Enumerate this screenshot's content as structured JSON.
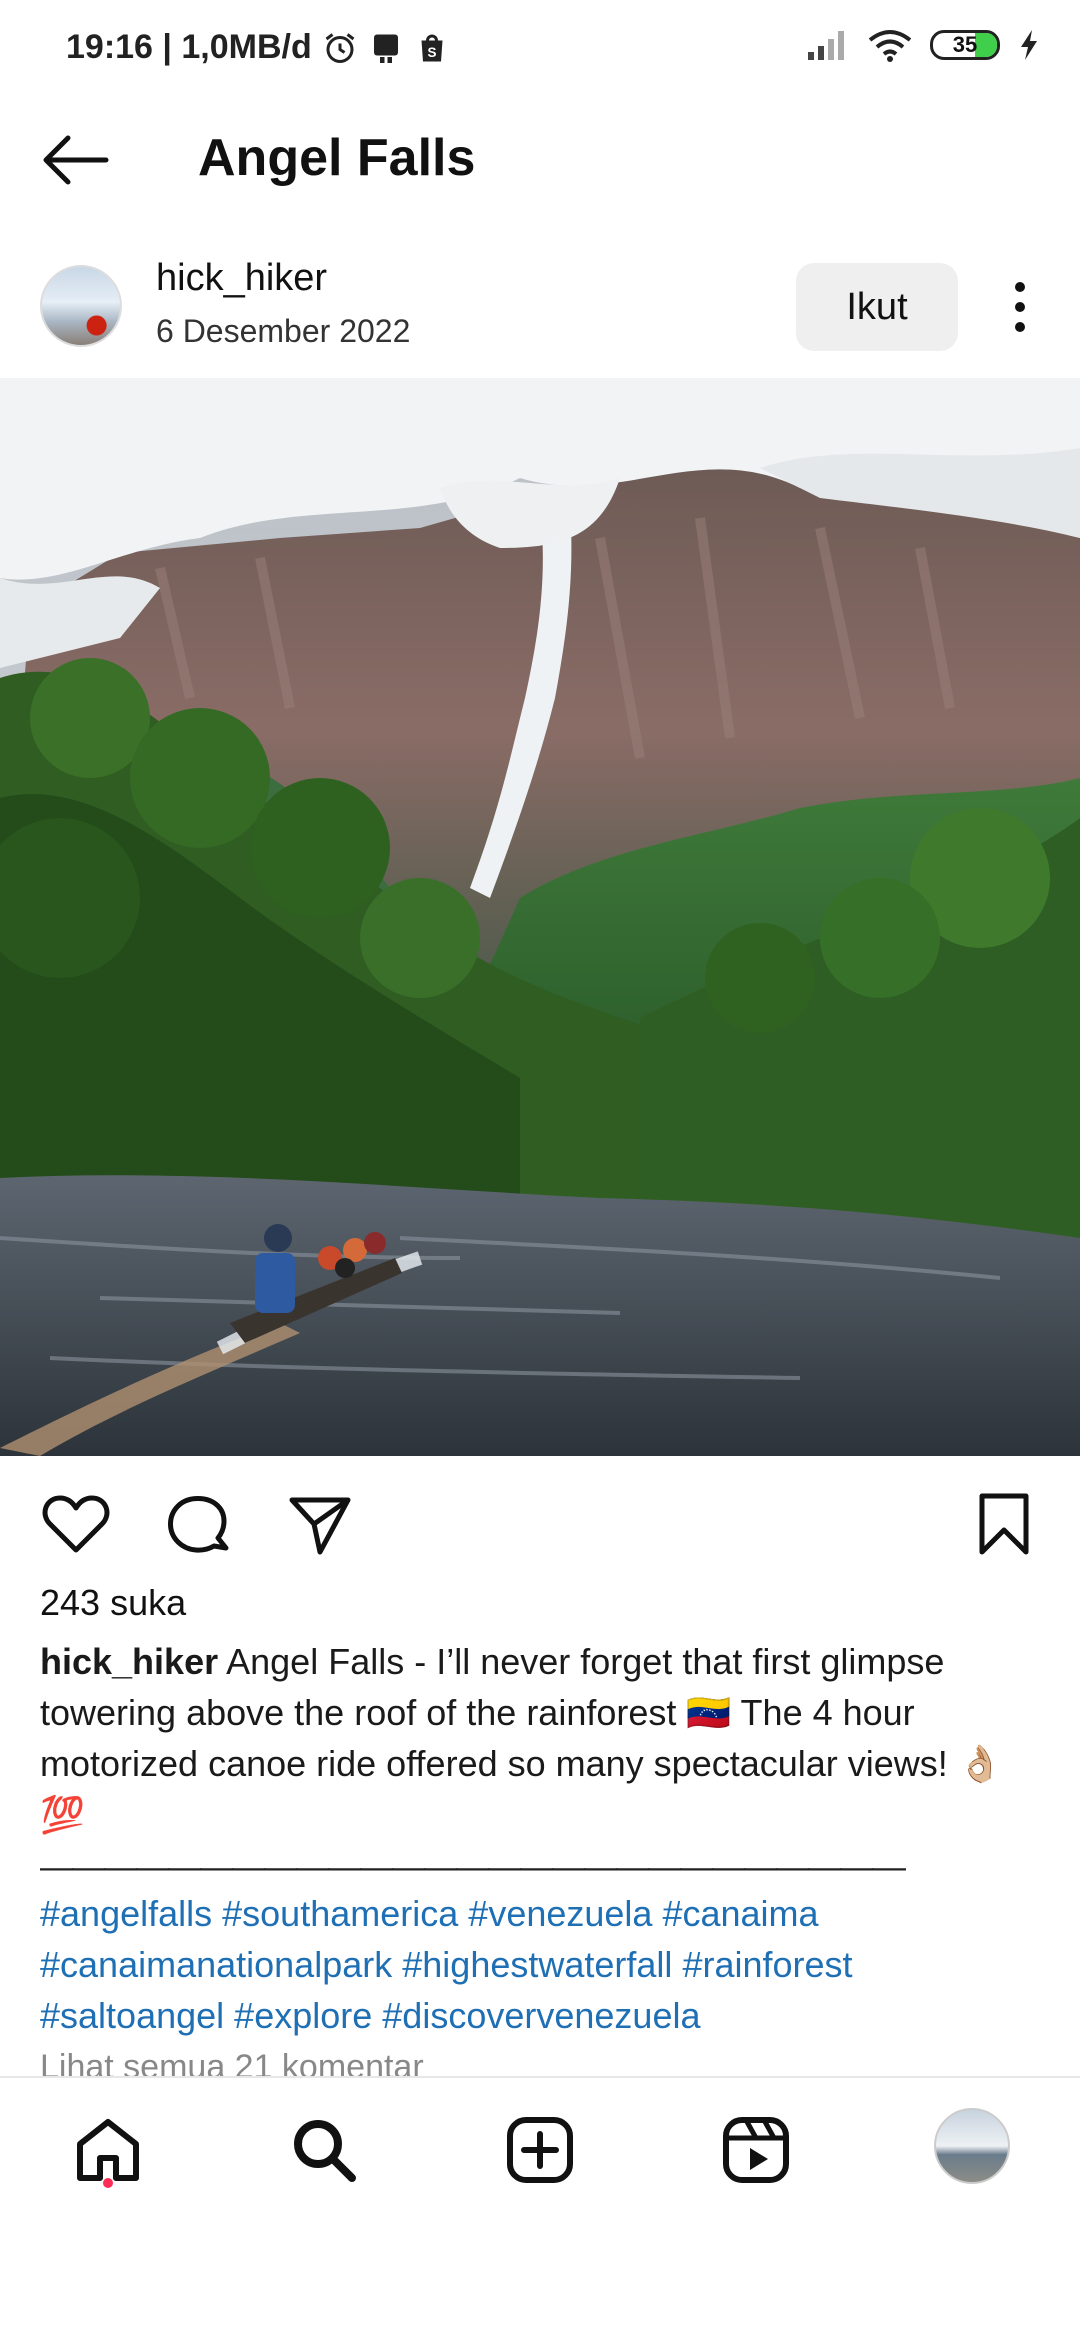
{
  "status": {
    "time_speed": "19:16 | 1,0MB/d",
    "battery": "35"
  },
  "header": {
    "title": "Angel Falls"
  },
  "post": {
    "username": "hick_hiker",
    "date": "6 Desember 2022",
    "follow_label": "Ikut",
    "likes": "243 suka",
    "caption_user": "hick_hiker",
    "caption_text": "Angel Falls - I’ll never forget that first glimpse towering above the roof of the rainforest 🇻🇪 The 4 hour motorized canoe ride offered so many spectacular views! 👌🏼💯",
    "divider": "———————————————————————————",
    "hashtags": [
      "#angelfalls",
      "#southamerica",
      "#venezuela",
      "#canaima",
      "#canaimanationalpark",
      "#highestwaterfall",
      "#rainforest",
      "#saltoangel",
      "#explore",
      "#discovervenezuela"
    ],
    "comments_link": "Lihat semua 21 komentar"
  },
  "icons": {
    "back": "arrow-left-icon",
    "more": "more-vertical-icon",
    "like": "heart-icon",
    "comment": "comment-icon",
    "share": "send-icon",
    "save": "bookmark-icon",
    "nav": [
      "home-icon",
      "search-icon",
      "create-icon",
      "reels-icon",
      "profile-avatar"
    ]
  },
  "colors": {
    "link": "#1f6fb5",
    "notify_dot": "#ff2d55",
    "follow_bg": "#efefef"
  }
}
